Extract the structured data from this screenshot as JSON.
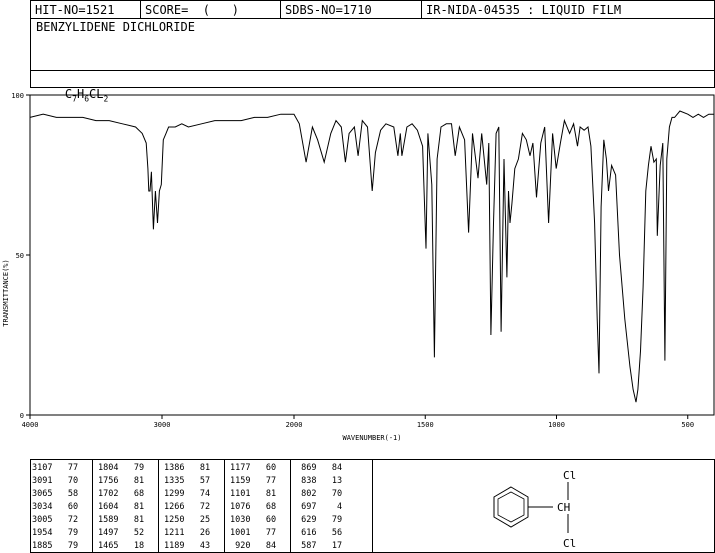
{
  "header": {
    "hit_no": "HIT-NO=1521",
    "score": "SCORE=  (   )",
    "sdbs_no": "SDBS-NO=1710",
    "ir_info": "IR-NIDA-04535 : LIQUID FILM"
  },
  "compound_name": "BENZYLIDENE DICHLORIDE",
  "formula": {
    "c": "C",
    "c_sub": "7",
    "h": "H",
    "h_sub": "6",
    "cl": "CL",
    "cl_sub": "2"
  },
  "chart_data": {
    "type": "line",
    "title": "",
    "xlabel": "WAVENUMBER(-1)",
    "ylabel": "TRANSMITTANCE(%)",
    "xlim": [
      4000,
      400
    ],
    "ylim": [
      0,
      100
    ],
    "x_ticks": [
      "4000",
      "3000",
      "2000",
      "1500",
      "1000",
      "500"
    ],
    "y_ticks": [
      "100",
      "50",
      "0"
    ],
    "series": [
      {
        "x": [
          4000,
          3900,
          3800,
          3700,
          3600,
          3500,
          3400,
          3300,
          3200,
          3150,
          3120,
          3107,
          3100,
          3091,
          3080,
          3065,
          3050,
          3034,
          3020,
          3005,
          2990,
          2970,
          2950,
          2900,
          2850,
          2800,
          2700,
          2600,
          2500,
          2400,
          2300,
          2200,
          2100,
          2050,
          2000,
          1980,
          1954,
          1930,
          1910,
          1885,
          1860,
          1840,
          1820,
          1804,
          1790,
          1770,
          1756,
          1740,
          1720,
          1702,
          1690,
          1670,
          1650,
          1620,
          1604,
          1595,
          1589,
          1570,
          1550,
          1530,
          1510,
          1497,
          1490,
          1475,
          1465,
          1455,
          1440,
          1420,
          1400,
          1386,
          1370,
          1350,
          1335,
          1320,
          1299,
          1285,
          1266,
          1258,
          1250,
          1240,
          1230,
          1220,
          1211,
          1200,
          1189,
          1183,
          1177,
          1170,
          1159,
          1145,
          1130,
          1115,
          1101,
          1090,
          1076,
          1060,
          1045,
          1030,
          1015,
          1001,
          985,
          970,
          950,
          935,
          920,
          910,
          895,
          880,
          869,
          855,
          845,
          838,
          830,
          820,
          810,
          802,
          790,
          775,
          760,
          740,
          720,
          708,
          697,
          690,
          680,
          670,
          660,
          650,
          640,
          629,
          620,
          616,
          605,
          595,
          587,
          580,
          570,
          560,
          550,
          530,
          500,
          480,
          460,
          440,
          420,
          400
        ],
        "y": [
          93,
          94,
          93,
          93,
          93,
          92,
          92,
          91,
          90,
          88,
          85,
          77,
          70,
          70,
          76,
          58,
          70,
          60,
          70,
          72,
          86,
          88,
          90,
          90,
          91,
          90,
          91,
          92,
          92,
          92,
          93,
          93,
          94,
          94,
          94,
          91,
          79,
          90,
          86,
          79,
          88,
          92,
          90,
          79,
          88,
          90,
          81,
          92,
          90,
          70,
          82,
          89,
          91,
          90,
          81,
          88,
          81,
          90,
          91,
          89,
          84,
          52,
          88,
          72,
          18,
          80,
          90,
          91,
          91,
          81,
          90,
          86,
          57,
          88,
          74,
          88,
          72,
          85,
          25,
          60,
          88,
          90,
          26,
          80,
          43,
          70,
          60,
          66,
          77,
          80,
          88,
          86,
          81,
          85,
          68,
          85,
          90,
          60,
          88,
          77,
          85,
          92,
          88,
          91,
          84,
          90,
          89,
          90,
          84,
          60,
          30,
          13,
          65,
          86,
          80,
          70,
          78,
          75,
          50,
          30,
          15,
          8,
          4,
          8,
          20,
          40,
          70,
          78,
          84,
          79,
          80,
          56,
          78,
          85,
          17,
          80,
          90,
          93,
          93,
          95,
          94,
          93,
          94,
          93,
          94,
          94
        ]
      }
    ],
    "peak_table": [
      [
        "3107",
        "77"
      ],
      [
        "3091",
        "70"
      ],
      [
        "3065",
        "58"
      ],
      [
        "3034",
        "60"
      ],
      [
        "3005",
        "72"
      ],
      [
        "1954",
        "79"
      ],
      [
        "1885",
        "79"
      ],
      [
        "1804",
        "79"
      ],
      [
        "1756",
        "81"
      ],
      [
        "1702",
        "68"
      ],
      [
        "1604",
        "81"
      ],
      [
        "1589",
        "81"
      ],
      [
        "1497",
        "52"
      ],
      [
        "1465",
        "18"
      ],
      [
        "1386",
        "81"
      ],
      [
        "1335",
        "57"
      ],
      [
        "1299",
        "74"
      ],
      [
        "1266",
        "72"
      ],
      [
        "1250",
        "25"
      ],
      [
        "1211",
        "26"
      ],
      [
        "1189",
        "43"
      ],
      [
        "1177",
        "60"
      ],
      [
        "1159",
        "77"
      ],
      [
        "1101",
        "81"
      ],
      [
        "1076",
        "68"
      ],
      [
        "1030",
        "60"
      ],
      [
        "1001",
        "77"
      ],
      [
        "920",
        "84"
      ],
      [
        "869",
        "84"
      ],
      [
        "838",
        "13"
      ],
      [
        "802",
        "70"
      ],
      [
        "697",
        "4"
      ],
      [
        "629",
        "79"
      ],
      [
        "616",
        "56"
      ],
      [
        "587",
        "17"
      ]
    ]
  },
  "structure": {
    "cl_top": "Cl",
    "ch": "CH",
    "cl_bottom": "Cl"
  }
}
